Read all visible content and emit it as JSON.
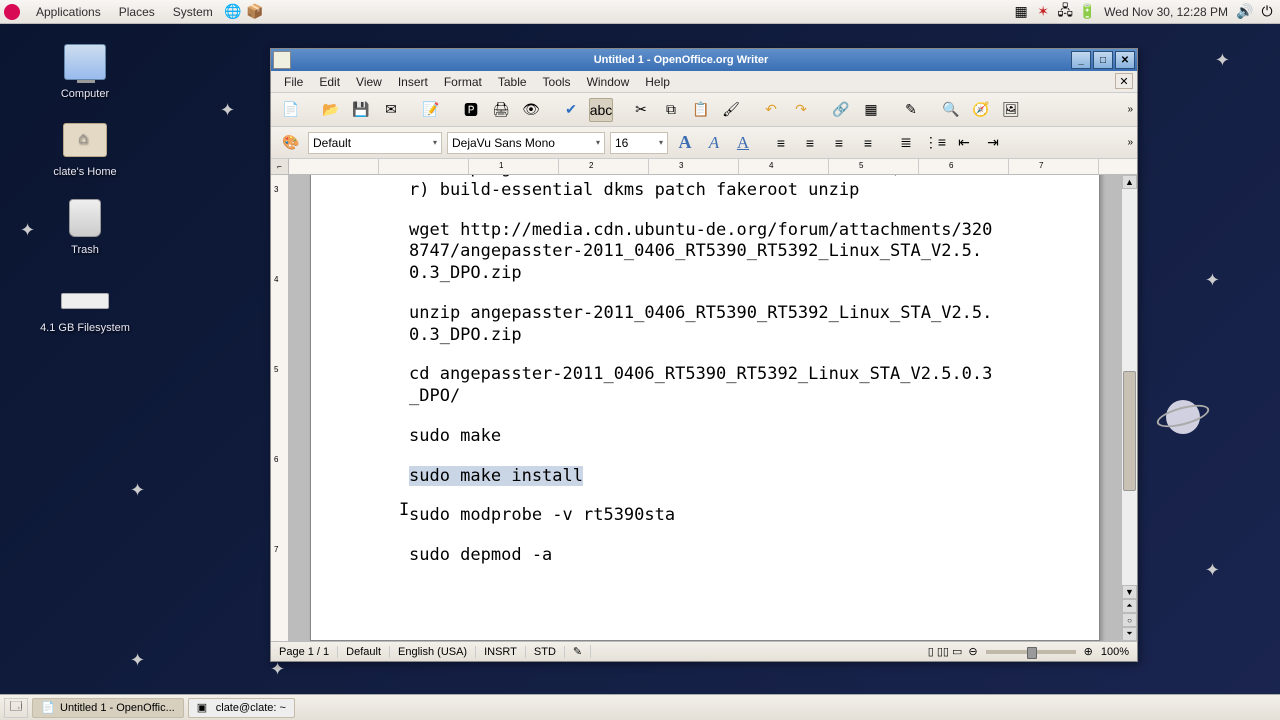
{
  "topbar": {
    "menus": {
      "applications": "Applications",
      "places": "Places",
      "system": "System"
    },
    "clock": "Wed Nov 30, 12:28 PM"
  },
  "desktop": {
    "icons": {
      "computer": "Computer",
      "home": "clate's Home",
      "trash": "Trash",
      "filesystem": "4.1 GB Filesystem"
    }
  },
  "window": {
    "title": "Untitled 1 - OpenOffice.org Writer",
    "menus": {
      "file": "File",
      "edit": "Edit",
      "view": "View",
      "insert": "Insert",
      "format": "Format",
      "table": "Table",
      "tools": "Tools",
      "window": "Window",
      "help": "Help"
    },
    "format": {
      "style": "Default",
      "font": "DejaVu Sans Mono",
      "size": "16"
    },
    "status": {
      "page": "Page 1 / 1",
      "style": "Default",
      "lang": "English (USA)",
      "insert": "INSRT",
      "sel": "STD",
      "zoom": "100%"
    }
  },
  "document": {
    "lines": [
      "sudo apt-get install --reinstall linux-headers-$(uname -r) build-essential dkms patch fakeroot unzip",
      "wget http://media.cdn.ubuntu-de.org/forum/attachments/3208747/angepasster-2011_0406_RT5390_RT5392_Linux_STA_V2.5.0.3_DPO.zip",
      "unzip angepasster-2011_0406_RT5390_RT5392_Linux_STA_V2.5.0.3_DPO.zip",
      "cd angepasster-2011_0406_RT5390_RT5392_Linux_STA_V2.5.0.3_DPO/",
      "sudo make",
      "sudo make install",
      "sudo modprobe -v rt5390sta",
      "sudo depmod -a"
    ],
    "selected_line_index": 5
  },
  "taskbar": {
    "tasks": {
      "writer": "Untitled 1 - OpenOffic...",
      "terminal": "clate@clate: ~"
    }
  }
}
